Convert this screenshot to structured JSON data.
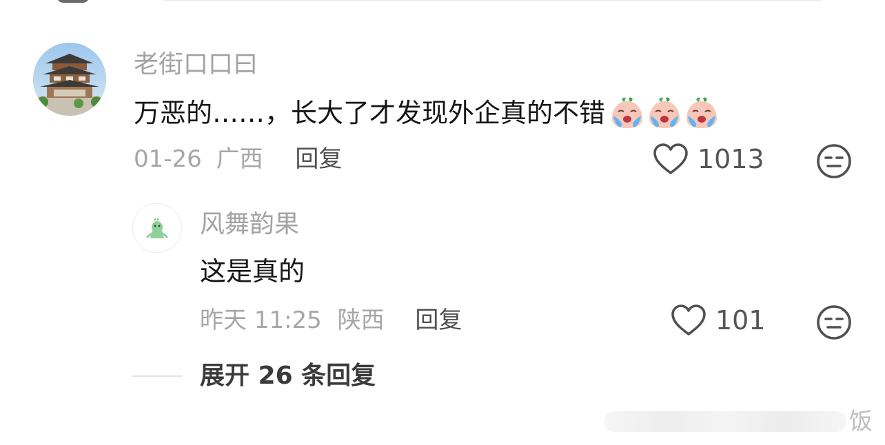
{
  "comment": {
    "username": "老街口口曰",
    "text": "万恶的……，长大了才发现外企真的不错",
    "emoji_icons": [
      "crying-peach-emoji",
      "crying-peach-emoji",
      "crying-peach-emoji"
    ],
    "date": "01-26",
    "location": "广西",
    "reply_label": "回复",
    "like_count": "1013"
  },
  "reply": {
    "username": "风舞韵果",
    "text": "这是真的",
    "date": "昨天 11:25",
    "location": "陕西",
    "reply_label": "回复",
    "like_count": "101"
  },
  "expand": {
    "label": "展开 26 条回复"
  },
  "watermark": {
    "text": "饭"
  },
  "colors": {
    "text_primary": "#161616",
    "text_secondary": "#a3a3a3",
    "reply_link": "#505050",
    "background": "#ffffff"
  }
}
